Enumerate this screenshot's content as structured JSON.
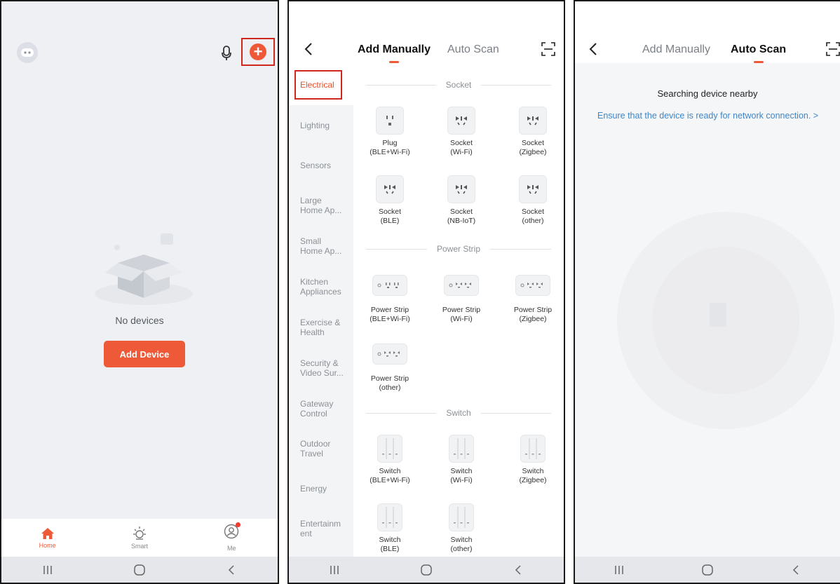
{
  "home_screen": {
    "empty_text": "No devices",
    "add_device_label": "Add Device",
    "tabs": [
      {
        "label": "Home",
        "icon": "home-icon",
        "active": true
      },
      {
        "label": "Smart",
        "icon": "smart-sun-icon",
        "active": false
      },
      {
        "label": "Me",
        "icon": "profile-icon",
        "active": false
      }
    ]
  },
  "add_screen": {
    "tabs": {
      "manual": "Add Manually",
      "auto": "Auto Scan"
    },
    "active_tab": "manual",
    "categories": [
      {
        "label": "Electrical",
        "active": true
      },
      {
        "label": "Lighting"
      },
      {
        "label": "Sensors"
      },
      {
        "label": "Large Home Ap..."
      },
      {
        "label": "Small Home Ap..."
      },
      {
        "label": "Kitchen Appliances"
      },
      {
        "label": "Exercise & Health"
      },
      {
        "label": "Security & Video Sur..."
      },
      {
        "label": "Gateway Control"
      },
      {
        "label": "Outdoor Travel"
      },
      {
        "label": "Energy"
      },
      {
        "label": "Entertainm ent"
      }
    ],
    "sections": [
      {
        "title": "Socket",
        "devices": [
          {
            "name": "Plug",
            "sub": "(BLE+Wi-Fi)"
          },
          {
            "name": "Socket",
            "sub": "(Wi-Fi)"
          },
          {
            "name": "Socket",
            "sub": "(Zigbee)"
          },
          {
            "name": "Socket",
            "sub": "(BLE)"
          },
          {
            "name": "Socket",
            "sub": "(NB-IoT)"
          },
          {
            "name": "Socket",
            "sub": "(other)"
          }
        ]
      },
      {
        "title": "Power Strip",
        "devices": [
          {
            "name": "Power Strip",
            "sub": "(BLE+Wi-Fi)"
          },
          {
            "name": "Power Strip",
            "sub": "(Wi-Fi)"
          },
          {
            "name": "Power Strip",
            "sub": "(Zigbee)"
          },
          {
            "name": "Power Strip",
            "sub": "(other)"
          }
        ]
      },
      {
        "title": "Switch",
        "devices": [
          {
            "name": "Switch",
            "sub": "(BLE+Wi-Fi)"
          },
          {
            "name": "Switch",
            "sub": "(Wi-Fi)"
          },
          {
            "name": "Switch",
            "sub": "(Zigbee)"
          },
          {
            "name": "Switch",
            "sub": "(BLE)"
          },
          {
            "name": "Switch",
            "sub": "(other)"
          }
        ]
      }
    ]
  },
  "scan_screen": {
    "tabs": {
      "manual": "Add Manually",
      "auto": "Auto Scan"
    },
    "active_tab": "auto",
    "searching_text": "Searching device nearby",
    "ensure_link": "Ensure that the device is ready for network connection. >"
  },
  "colors": {
    "accent": "#ee5a38",
    "highlight_border": "#d0271d",
    "link": "#3f85c7"
  }
}
